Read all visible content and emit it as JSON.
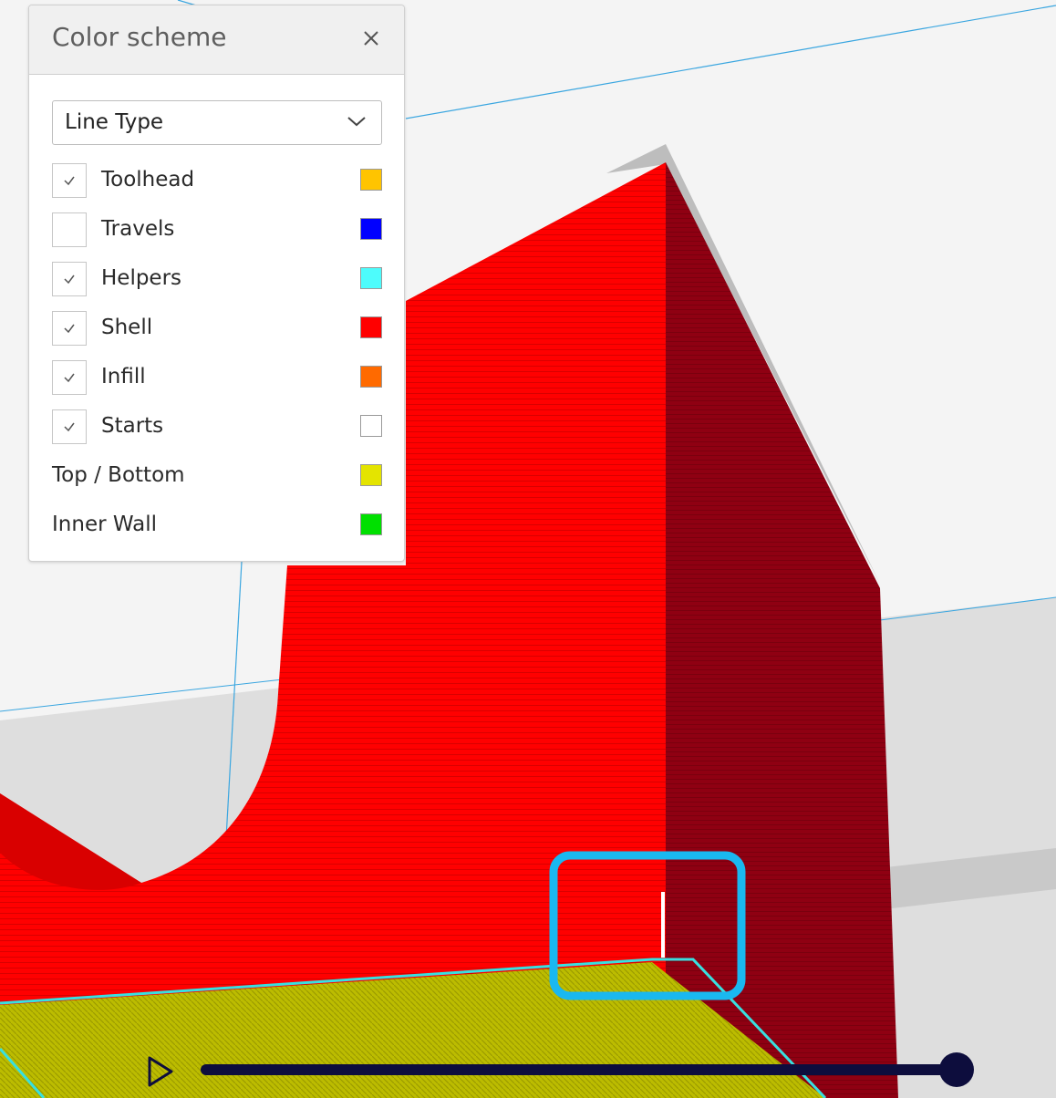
{
  "panel": {
    "title": "Color scheme",
    "close_icon": "close-icon",
    "dropdown": {
      "selected": "Line Type",
      "icon": "chevron-down-icon"
    },
    "items": [
      {
        "label": "Toolhead",
        "checked": true,
        "color": "#ffc400"
      },
      {
        "label": "Travels",
        "checked": false,
        "color": "#0000ff"
      },
      {
        "label": "Helpers",
        "checked": true,
        "color": "#4dfcfc"
      },
      {
        "label": "Shell",
        "checked": true,
        "color": "#ff0000"
      },
      {
        "label": "Infill",
        "checked": true,
        "color": "#ff6a00"
      },
      {
        "label": "Starts",
        "checked": true,
        "color": "#ffffff"
      },
      {
        "label": "Top / Bottom",
        "checked": null,
        "color": "#e4e400"
      },
      {
        "label": "Inner Wall",
        "checked": null,
        "color": "#00e000"
      }
    ]
  },
  "annotations": {
    "arrow_color": "#1ab8f0",
    "highlight_box_color": "#1ab8f0"
  },
  "playback": {
    "play_icon": "play-icon",
    "progress": 0.98
  },
  "scene": {
    "shell_color": "#ff0000",
    "shell_shadow_color": "#8f0012",
    "top_bottom_color": "#b6b600",
    "background_color": "#f4f4f4"
  }
}
